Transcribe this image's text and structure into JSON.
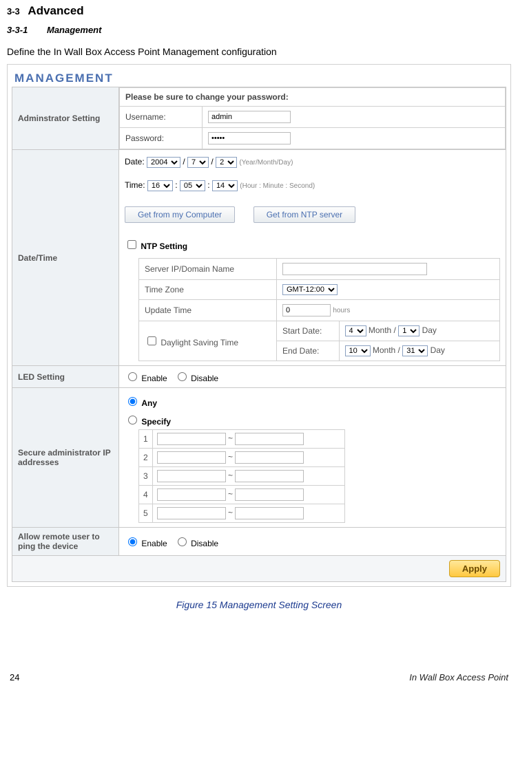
{
  "section": {
    "number": "3-3",
    "title": "Advanced"
  },
  "subsection": {
    "number": "3-3-1",
    "title": "Management"
  },
  "intro": "Define the In Wall Box Access Point Management configuration",
  "mgmt_heading": "MANAGEMENT",
  "admin": {
    "row_label": "Adminstrator Setting",
    "notice": "Please be sure to change your password:",
    "username_label": "Username:",
    "username_value": "admin",
    "password_label": "Password:",
    "password_value": "•••••"
  },
  "datetime": {
    "row_label": "Date/Time",
    "date_label": "Date:",
    "year": "2004",
    "month": "7",
    "day": "2",
    "date_hint": "(Year/Month/Day)",
    "time_label": "Time:",
    "hour": "16",
    "minute": "05",
    "second": "14",
    "time_hint": "(Hour : Minute : Second)",
    "btn_computer": "Get from my Computer",
    "btn_ntp": "Get from NTP server",
    "ntp_label": "NTP Setting",
    "server_label": "Server IP/Domain Name",
    "server_value": "",
    "tz_label": "Time Zone",
    "tz_value": "GMT-12:00",
    "update_label": "Update Time",
    "update_value": "0",
    "update_unit": "hours",
    "dst_label": "Daylight Saving Time",
    "start_label": "Start Date:",
    "start_month": "4",
    "start_day": "1",
    "end_label": "End Date:",
    "end_month": "10",
    "end_day": "31",
    "month_text": "Month /",
    "day_text": "Day"
  },
  "led": {
    "row_label": "LED Setting",
    "enable": "Enable",
    "disable": "Disable"
  },
  "secure": {
    "row_label": "Secure administrator IP addresses",
    "any": "Any",
    "specify": "Specify",
    "rows": [
      "1",
      "2",
      "3",
      "4",
      "5"
    ],
    "sep": "~"
  },
  "ping": {
    "row_label": "Allow remote user to ping the device",
    "enable": "Enable",
    "disable": "Disable"
  },
  "apply_label": "Apply",
  "figure_caption": "Figure 15 Management Setting Screen",
  "footer": {
    "page": "24",
    "title": "In Wall Box Access Point"
  }
}
